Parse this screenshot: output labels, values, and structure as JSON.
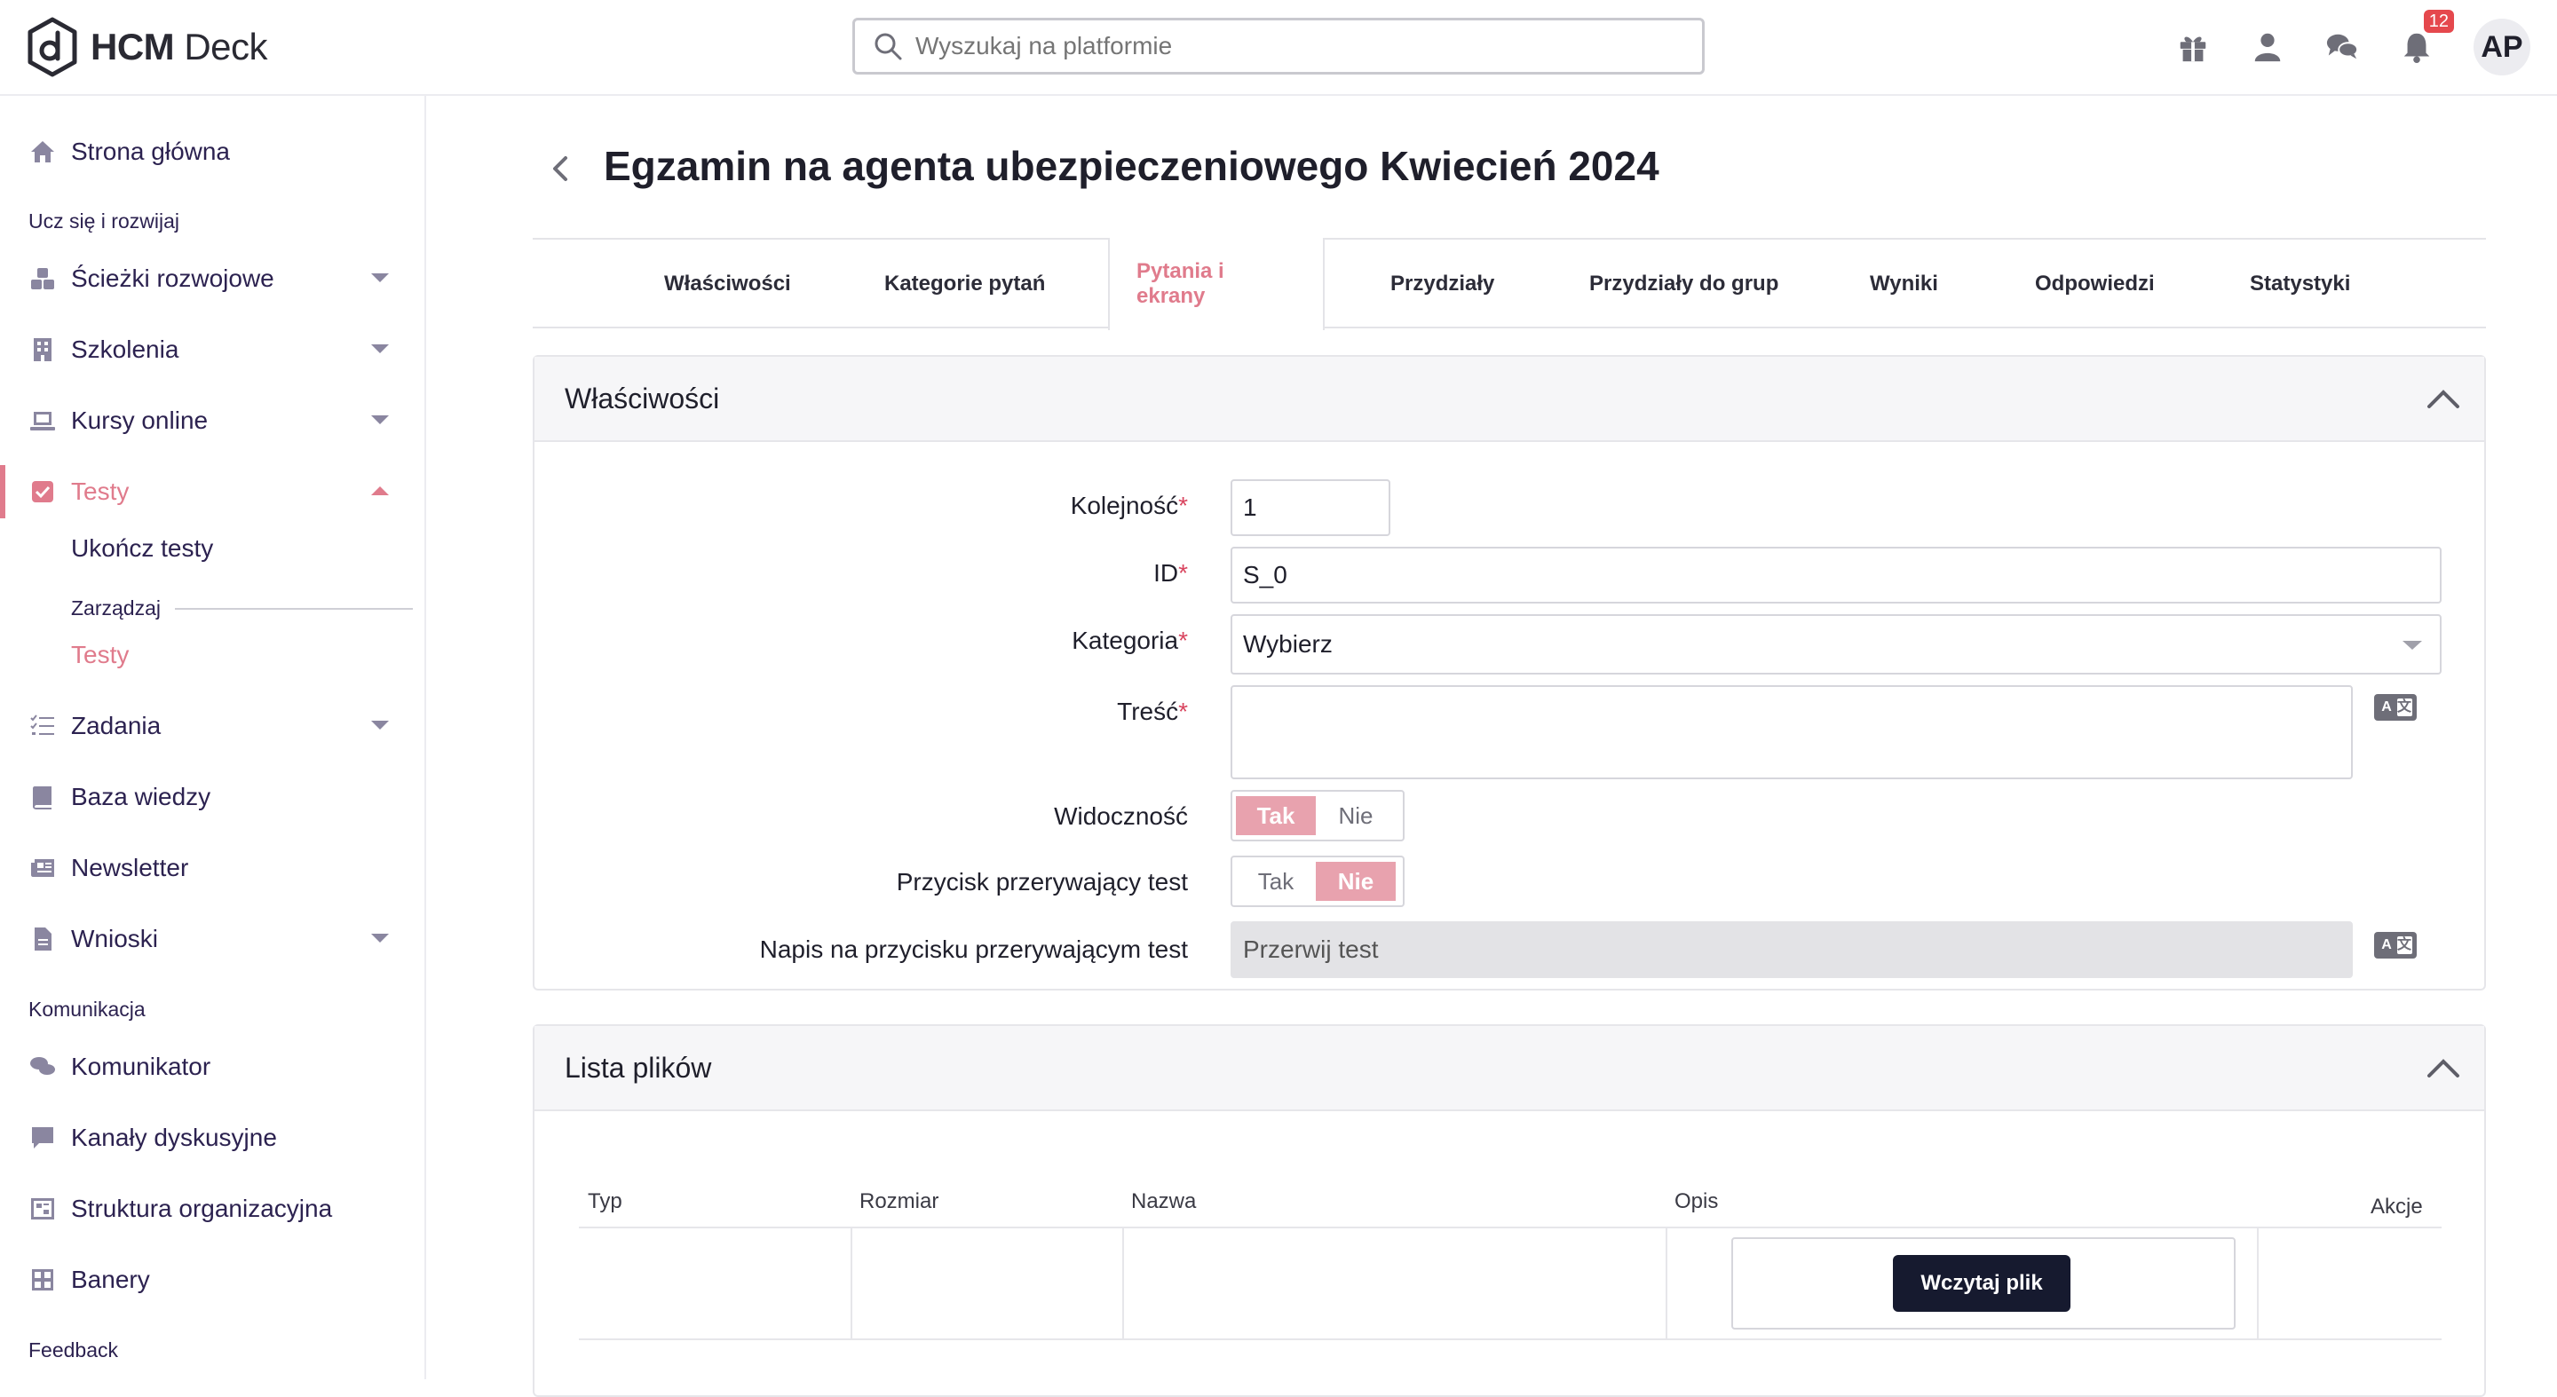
{
  "app": {
    "brand_bold": "HCM",
    "brand_rest": " Deck"
  },
  "search": {
    "placeholder": "Wyszukaj na platformie"
  },
  "topbar": {
    "notifications_count": "12",
    "avatar_initials": "AP"
  },
  "sidebar": {
    "home": "Strona główna",
    "section_learn": "Ucz się i rozwijaj",
    "paths": "Ścieżki rozwojowe",
    "trainings": "Szkolenia",
    "courses": "Kursy online",
    "tests": "Testy",
    "finish_tests": "Ukończ testy",
    "manage": "Zarządzaj",
    "tests_sub": "Testy",
    "tasks": "Zadania",
    "knowledge": "Baza wiedzy",
    "newsletter": "Newsletter",
    "requests": "Wnioski",
    "section_comm": "Komunikacja",
    "messenger": "Komunikator",
    "channels": "Kanały dyskusyjne",
    "org": "Struktura organizacyjna",
    "banners": "Banery",
    "section_feedback": "Feedback"
  },
  "page": {
    "title": "Egzamin na agenta ubezpieczeniowego Kwiecień 2024"
  },
  "tabs": [
    "Właściwości",
    "Kategorie pytań",
    "Pytania i ekrany",
    "Przydziały",
    "Przydziały do grup",
    "Wyniki",
    "Odpowiedzi",
    "Statystyki"
  ],
  "properties": {
    "title": "Właściwości",
    "order_label": "Kolejność",
    "order_value": "1",
    "id_label": "ID",
    "id_value": "S_0",
    "category_label": "Kategoria",
    "category_value": "Wybierz",
    "content_label": "Treść",
    "visibility_label": "Widoczność",
    "break_button_label": "Przycisk przerywający test",
    "break_caption_label": "Napis na przycisku przerywającym test",
    "break_caption_value": "Przerwij test",
    "yes": "Tak",
    "no": "Nie",
    "required_mark": "*",
    "lang_a": "A",
    "lang_b": "文",
    "visibility_selected": "Tak",
    "break_button_selected": "Nie"
  },
  "files": {
    "title": "Lista plików",
    "columns": [
      "Typ",
      "Rozmiar",
      "Nazwa",
      "Opis",
      "Akcje"
    ],
    "upload_label": "Wczytaj plik"
  },
  "colors": {
    "accent": "#e07b8c",
    "toggle_on": "#e8a2ae",
    "dark_button": "#161a2f"
  }
}
